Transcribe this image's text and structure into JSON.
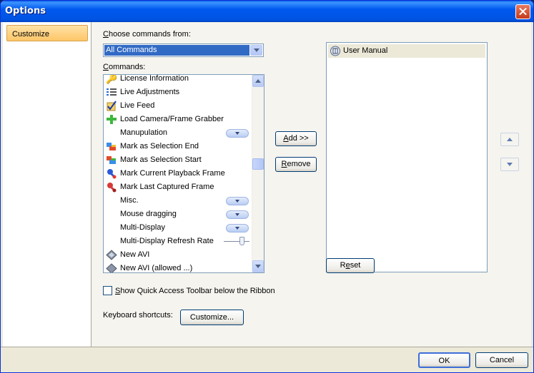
{
  "window": {
    "title": "Options"
  },
  "nav": {
    "items": [
      {
        "label": "Customize"
      }
    ]
  },
  "choose_commands": {
    "label_key": "C",
    "label_rest": "hoose commands from:",
    "selected": "All Commands"
  },
  "commands": {
    "label_key": "C",
    "label_rest": "ommands:",
    "items": [
      {
        "label": "License Information",
        "icon": "key-icon"
      },
      {
        "label": "Live Adjustments",
        "icon": "adjustments-list-icon"
      },
      {
        "label": "Live Feed",
        "icon": "checkmark-icon"
      },
      {
        "label": "Load Camera/Frame Grabber",
        "icon": "green-plus-icon"
      },
      {
        "label": "Manupulation",
        "icon": "",
        "control": "dropdown"
      },
      {
        "label": "Mark as Selection End",
        "icon": "selection-end-icon"
      },
      {
        "label": "Mark as Selection Start",
        "icon": "selection-start-icon"
      },
      {
        "label": "Mark Current Playback Frame",
        "icon": "pushpin-blue-icon"
      },
      {
        "label": "Mark Last Captured Frame",
        "icon": "pushpin-red-icon"
      },
      {
        "label": "Misc.",
        "icon": "",
        "control": "dropdown"
      },
      {
        "label": "Mouse dragging",
        "icon": "",
        "control": "dropdown"
      },
      {
        "label": "Multi-Display",
        "icon": "",
        "control": "dropdown"
      },
      {
        "label": "Multi-Display Refresh Rate",
        "icon": "",
        "control": "slider"
      },
      {
        "label": "New AVI",
        "icon": "avi-diamond-icon"
      },
      {
        "label": "New AVI (allowed ...)",
        "icon": "avi-diamond-icon"
      }
    ]
  },
  "buttons": {
    "add_key": "A",
    "add_rest": "dd >>",
    "remove_key": "R",
    "remove_rest": "emove",
    "reset_pre": "R",
    "reset_key": "e",
    "reset_rest": "set",
    "customize": "Customize...",
    "ok": "OK",
    "cancel": "Cancel"
  },
  "quick_access": {
    "items": [
      {
        "label": "User Manual",
        "icon": "manual-icon"
      }
    ]
  },
  "show_qat": {
    "label_key": "S",
    "label_rest": "how Quick Access Toolbar below the Ribbon",
    "checked": false
  },
  "keyboard_shortcuts": {
    "label": "Keyboard shortcuts:"
  },
  "colors": {
    "selection": "#316ac5",
    "nav_selected": "#fdc667",
    "title_bar": "#0054e3"
  }
}
